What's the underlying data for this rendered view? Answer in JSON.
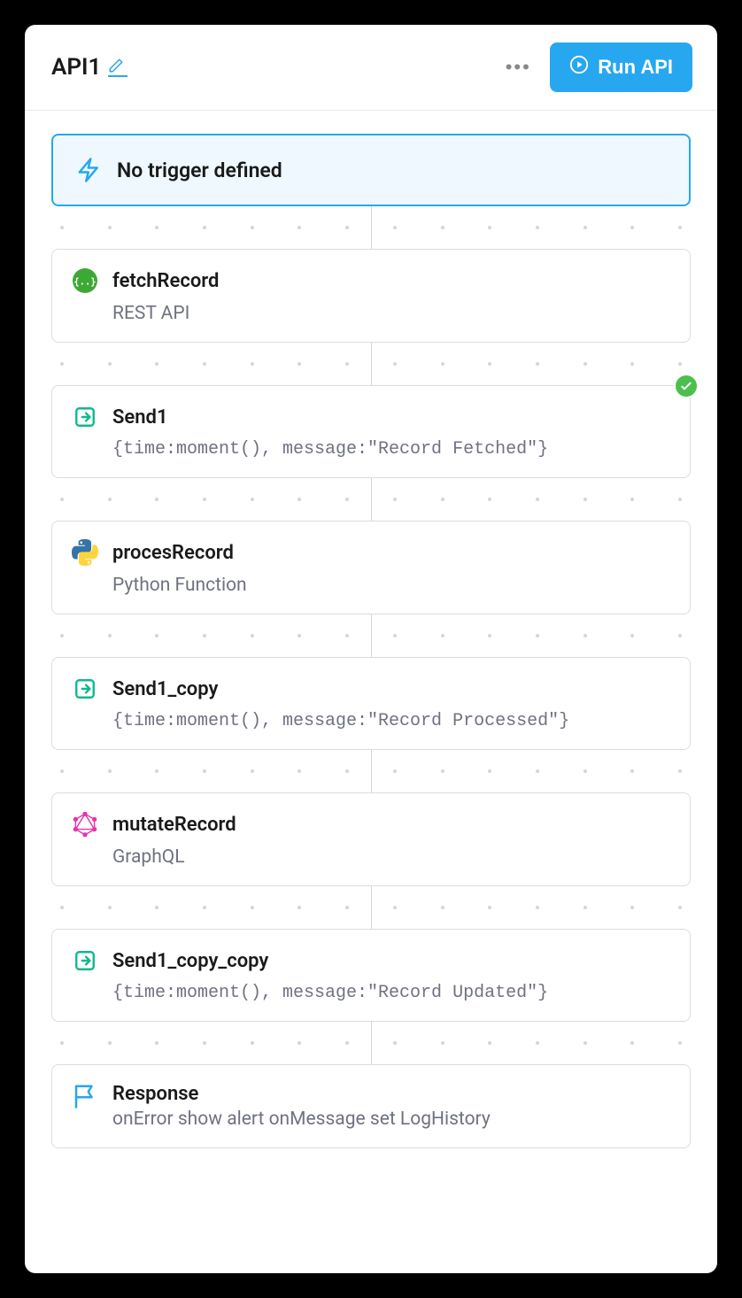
{
  "header": {
    "title": "API1",
    "run_label": "Run API"
  },
  "trigger": {
    "label": "No trigger defined"
  },
  "blocks": [
    {
      "icon": "rest",
      "title": "fetchRecord",
      "subtitle": "REST API",
      "mono": false,
      "check": false
    },
    {
      "icon": "send",
      "title": "Send1",
      "subtitle": "{time:moment(), message:\"Record Fetched\"}",
      "mono": true,
      "check": true
    },
    {
      "icon": "python",
      "title": "procesRecord",
      "subtitle": "Python Function",
      "mono": false,
      "check": false
    },
    {
      "icon": "send",
      "title": "Send1_copy",
      "subtitle": "{time:moment(), message:\"Record Processed\"}",
      "mono": true,
      "check": false
    },
    {
      "icon": "graphql",
      "title": "mutateRecord",
      "subtitle": "GraphQL",
      "mono": false,
      "check": false
    },
    {
      "icon": "send",
      "title": "Send1_copy_copy",
      "subtitle": "{time:moment(), message:\"Record Updated\"}",
      "mono": true,
      "check": false
    }
  ],
  "response": {
    "title": "Response",
    "subtitle": "onError show alert onMessage set LogHistory"
  }
}
